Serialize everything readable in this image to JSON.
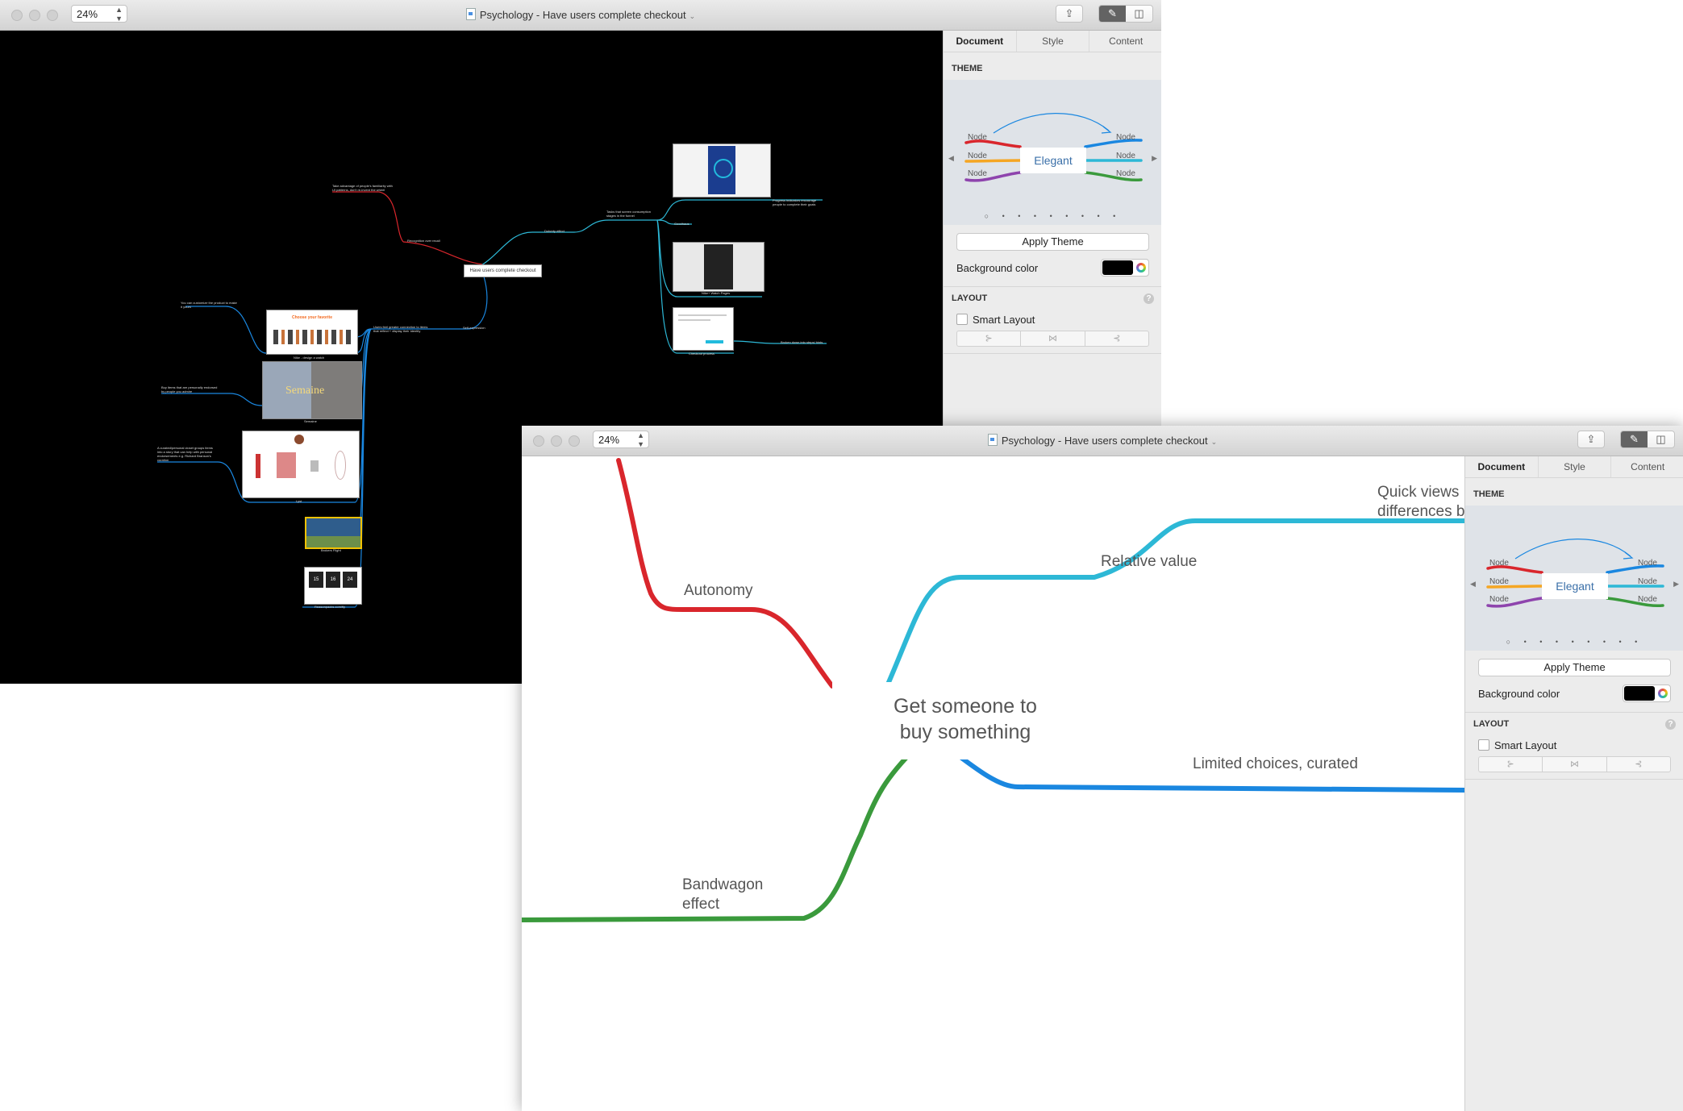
{
  "window": {
    "title": "Psychology - Have users complete checkout",
    "zoom": "24%"
  },
  "sidebar": {
    "tabs": [
      "Document",
      "Style",
      "Content"
    ],
    "active_tab": "Document",
    "theme_header": "THEME",
    "theme_preview": {
      "name": "Elegant",
      "node_label": "Node",
      "page_dots": "○ • • • • • • • •"
    },
    "apply_theme": "Apply Theme",
    "background_color_label": "Background color",
    "background_color": "#000000",
    "layout_header": "LAYOUT",
    "help_icon": "?",
    "smart_layout": "Smart Layout",
    "smart_layout_checked": false
  },
  "overview_map": {
    "central_topic": "Have users complete checkout",
    "branches": [
      "Recognition over recall",
      "Doherty effect",
      "Self-expression"
    ],
    "notes": [
      "Take advantage of people's familiarity with UI patterns, don't re-invent the wheel",
      "Tasks that screen consumption stages in the funnel",
      "Progress indicators encourage people to complete their goals",
      "Goodhaus",
      "Nike+ Watch Pages",
      "Broken down into steps/ hints",
      "Checkout process",
      "You can customize the product to make it yours",
      "Nike - design a watch",
      "Buy items that are personally endorsed by people you admire",
      "Semaine",
      "A curated/personal closet groups items into a story that can help with personal endorsements e.g. Richard Branson's curation",
      "Lyst",
      "Brokers Flight",
      "Reasonpacks.com/fly",
      "Users feel greater connection to items that reflect + display their identity"
    ],
    "thumbnails": {
      "choose_title": "Choose your favorite",
      "semaine_title": "Semaine",
      "countdown": [
        "15",
        "16",
        "24"
      ]
    }
  },
  "detail_map": {
    "central_topic_line1": "Get someone to",
    "central_topic_line2": "buy something",
    "topics": {
      "autonomy": "Autonomy",
      "relative_value": "Relative value",
      "quick_views_line1": "Quick views",
      "quick_views_line2": "differences b",
      "limited_choices": "Limited choices, curated",
      "bandwagon_line1": "Bandwagon",
      "bandwagon_line2": "effect"
    }
  },
  "colors": {
    "red": "#d9262c",
    "cyan": "#2db8d6",
    "blue": "#1a87e0",
    "green": "#3a9a3c",
    "orange": "#f5a623",
    "purple": "#8e44ad"
  }
}
